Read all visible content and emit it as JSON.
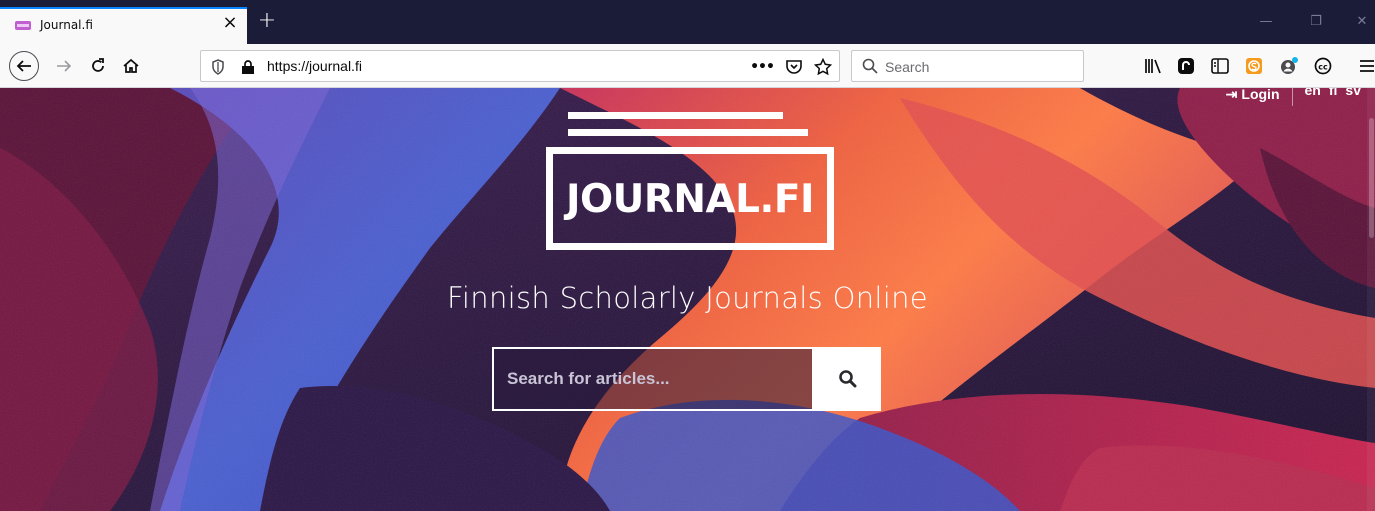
{
  "browser": {
    "tab": {
      "title": "Journal.fi"
    },
    "url": "https://journal.fi",
    "search_placeholder": "Search",
    "overflow_label": "•••"
  },
  "header": {
    "login_label": "Login",
    "languages": [
      "en",
      "fi",
      "sv"
    ]
  },
  "hero": {
    "logo_text": "JOURNAL.FI",
    "tagline": "Finnish Scholarly Journals Online",
    "search_placeholder": "Search for articles..."
  },
  "colors": {
    "tab_accent": "#0a84ff",
    "tabbar_bg": "#1b1c37",
    "toolbar_bg": "#f9f9fa"
  },
  "icons": [
    "back-icon",
    "forward-icon",
    "reload-icon",
    "home-icon",
    "tracking-protection-icon",
    "lock-icon",
    "page-actions-icon",
    "pocket-icon",
    "bookmark-star-icon",
    "search-icon",
    "library-icon",
    "extension-icon",
    "sidebar-icon",
    "extension-s-icon",
    "extension-user-icon",
    "creative-commons-icon",
    "menu-icon",
    "login-icon",
    "magnifier-icon"
  ]
}
